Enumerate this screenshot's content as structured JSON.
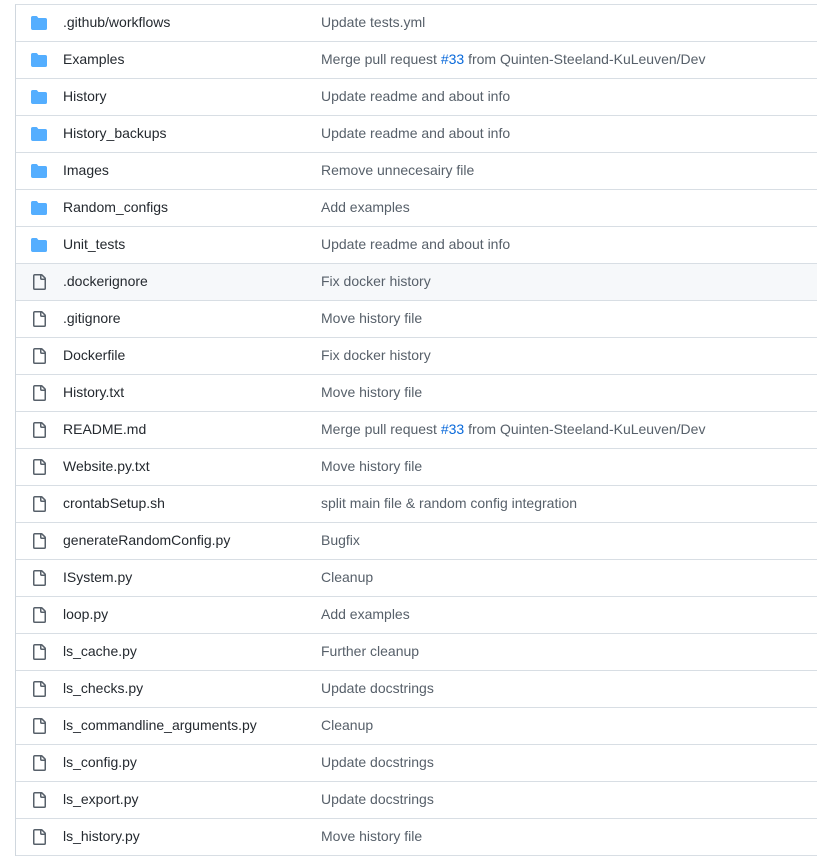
{
  "rows": [
    {
      "type": "folder",
      "name": ".github/workflows",
      "message": "Update tests.yml"
    },
    {
      "type": "folder",
      "name": "Examples",
      "message_pre": "Merge pull request ",
      "pr": "#33",
      "message_post": " from Quinten-Steeland-KuLeuven/Dev"
    },
    {
      "type": "folder",
      "name": "History",
      "message": "Update readme and about info"
    },
    {
      "type": "folder",
      "name": "History_backups",
      "message": "Update readme and about info"
    },
    {
      "type": "folder",
      "name": "Images",
      "message": "Remove unnecesairy file"
    },
    {
      "type": "folder",
      "name": "Random_configs",
      "message": "Add examples"
    },
    {
      "type": "folder",
      "name": "Unit_tests",
      "message": "Update readme and about info"
    },
    {
      "type": "file",
      "name": ".dockerignore",
      "message": "Fix docker history",
      "hovered": true
    },
    {
      "type": "file",
      "name": ".gitignore",
      "message": "Move history file"
    },
    {
      "type": "file",
      "name": "Dockerfile",
      "message": "Fix docker history"
    },
    {
      "type": "file",
      "name": "History.txt",
      "message": "Move history file"
    },
    {
      "type": "file",
      "name": "README.md",
      "message_pre": "Merge pull request ",
      "pr": "#33",
      "message_post": " from Quinten-Steeland-KuLeuven/Dev"
    },
    {
      "type": "file",
      "name": "Website.py.txt",
      "message": "Move history file"
    },
    {
      "type": "file",
      "name": "crontabSetup.sh",
      "message": "split main file & random config integration"
    },
    {
      "type": "file",
      "name": "generateRandomConfig.py",
      "message": "Bugfix"
    },
    {
      "type": "file",
      "name": "ISystem.py",
      "message": "Cleanup"
    },
    {
      "type": "file",
      "name": "loop.py",
      "message": "Add examples"
    },
    {
      "type": "file",
      "name": "ls_cache.py",
      "message": "Further cleanup"
    },
    {
      "type": "file",
      "name": "ls_checks.py",
      "message": "Update docstrings"
    },
    {
      "type": "file",
      "name": "ls_commandline_arguments.py",
      "message": "Cleanup"
    },
    {
      "type": "file",
      "name": "ls_config.py",
      "message": "Update docstrings"
    },
    {
      "type": "file",
      "name": "ls_export.py",
      "message": "Update docstrings"
    },
    {
      "type": "file",
      "name": "ls_history.py",
      "message": "Move history file"
    }
  ],
  "colors": {
    "folder_icon": "#54aeff",
    "file_icon": "#57606a",
    "link": "#0969da"
  },
  "icons": {
    "folder": "folder-icon",
    "file": "file-icon"
  }
}
